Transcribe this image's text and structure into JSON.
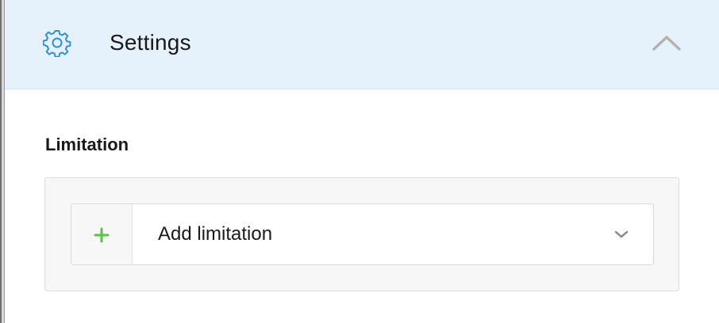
{
  "header": {
    "icon": "gear-icon",
    "title": "Settings",
    "collapse_icon": "chevron-up-icon",
    "accent_color": "#2d8fe0",
    "background_color": "#e6f2fb"
  },
  "limitation": {
    "section_label": "Limitation",
    "add_select": {
      "icon": "plus-icon",
      "icon_color": "#5cc14a",
      "label": "Add limitation",
      "dropdown_icon": "chevron-down-icon"
    }
  }
}
